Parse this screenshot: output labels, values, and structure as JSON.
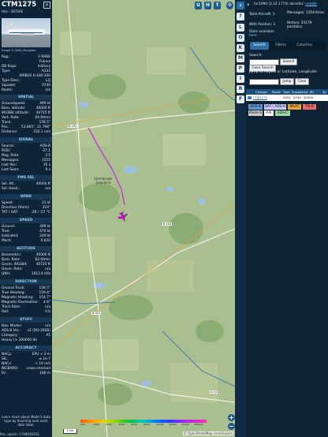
{
  "infoblock": {
    "callsign": "CTM1275",
    "hex_line": "Hex : 3B76AE",
    "photo_credit": "Image © JSMD_Mongabe",
    "reg_rows": [
      {
        "label": "Reg.:",
        "value": "F-RARE"
      },
      {
        "label": "",
        "value": "France"
      },
      {
        "label": "DB flags:",
        "value": "military"
      },
      {
        "label": "Type:",
        "value": "A332"
      },
      {
        "label": "",
        "value": "AIRBUS A-330-200"
      },
      {
        "label": "Type Desc.:",
        "value": "L2J"
      },
      {
        "label": "Squawk:",
        "value": "0740"
      },
      {
        "label": "Route:",
        "value": "n/a"
      }
    ],
    "sections": [
      {
        "title": "SPATIAL",
        "rows": [
          {
            "label": "Groundspeed:",
            "value": "499 kt"
          },
          {
            "label": "Baro. altitude:",
            "value": "40000 ft"
          },
          {
            "label": "WGS84 altitude:",
            "value": "40725 ft"
          },
          {
            "label": "Vert. Rate:",
            "value": "64 ft/min"
          },
          {
            "label": "Track:",
            "value": "158.5°"
          },
          {
            "label": "Pos.:",
            "value": "53.665°, 11.798°"
          },
          {
            "label": "Distance:",
            "value": "232.1 nmi"
          }
        ]
      },
      {
        "title": "SIGNAL",
        "rows": [
          {
            "label": "Source:",
            "value": "ADS-B"
          },
          {
            "label": "RSSI:",
            "value": "-27.1"
          },
          {
            "label": "Msg. Rate:",
            "value": "3.5"
          },
          {
            "label": "Messages:",
            "value": "1555"
          },
          {
            "label": "Last Pos.:",
            "value": "35 s"
          },
          {
            "label": "Last Seen:",
            "value": "0 s"
          }
        ]
      },
      {
        "title": "FMS SEL",
        "rows": [
          {
            "label": "Sel. Alt.:",
            "value": "40000 ft"
          },
          {
            "label": "Sel. Head.:",
            "value": "n/a"
          }
        ]
      },
      {
        "title": "WIND",
        "rows": [
          {
            "label": "Speed:",
            "value": "31 kt"
          },
          {
            "label": "Direction (from):",
            "value": "319°"
          },
          {
            "label": "TAT / OAT:",
            "value": "-28 / -57 °C"
          }
        ]
      },
      {
        "title": "SPEED",
        "rows": [
          {
            "label": "Ground:",
            "value": "499 kt"
          },
          {
            "label": "True:",
            "value": "470 kt"
          },
          {
            "label": "Indicated:",
            "value": "249 kt"
          },
          {
            "label": "Mach:",
            "value": "0.820"
          }
        ]
      },
      {
        "title": "ALTITUDE",
        "rows": [
          {
            "label": "Barometric:",
            "value": "40000 ft"
          },
          {
            "label": "Baro. Rate:",
            "value": "64 ft/min"
          },
          {
            "label": "Geom. WGS84:",
            "value": "40725 ft"
          },
          {
            "label": "Geom. Rate:",
            "value": "n/a"
          },
          {
            "label": "QNH:",
            "value": "1013.6 hPa"
          }
        ]
      },
      {
        "title": "DIRECTION",
        "rows": [
          {
            "label": "Ground Track:",
            "value": "158.5°"
          },
          {
            "label": "True Heading:",
            "value": "159.4°"
          },
          {
            "label": "Magnetic Heading:",
            "value": "154.7°"
          },
          {
            "label": "Magnetic Declination:",
            "value": "4.8°"
          },
          {
            "label": "Track Rate:",
            "value": "n/a"
          },
          {
            "label": "Roll:",
            "value": "0.0"
          }
        ]
      },
      {
        "title": "STUFF",
        "rows": [
          {
            "label": "Nav. Modes:",
            "value": "n/a"
          },
          {
            "label": "ADS-B Ver.:",
            "value": "v2 (DO-260B)"
          },
          {
            "label": "Category:",
            "value": "A5"
          },
          {
            "label": "Heavy (> 300000 lb)",
            "value": ""
          }
        ]
      },
      {
        "title": "ACCURACY",
        "rows": [
          {
            "label": "NACp:",
            "value": "EPU < 3 m"
          },
          {
            "label": "SIL:",
            "value": "≤ 1e-7"
          },
          {
            "label": "NACv:",
            "value": "< 10 m/s"
          },
          {
            "label": "NICBARO:",
            "value": "cross-checked"
          },
          {
            "label": "Rc:",
            "value": "186 m"
          }
        ]
      }
    ],
    "learn_more": "Learn more about Mode S data type by hovering over each data label.",
    "epoch": "Pos. epoch: 1748019353"
  },
  "map": {
    "controls": {
      "u": "U",
      "h": "H",
      "t": "T"
    },
    "zoom_in": "+",
    "zoom_out": "−",
    "scale_label": "1 km",
    "osm_credit": "© OpenStreetMap contributors",
    "town_label": "Sternberger Seenland",
    "road_labels": [
      "B 192",
      "B 104",
      "B 321",
      "A 14"
    ],
    "altitude_legend_ticks": [
      "500",
      "1000",
      "2000",
      "4000",
      "6000",
      "8000",
      "10000",
      "20000",
      "30000",
      "40000+"
    ],
    "aircraft_color": "#d40ad8",
    "track_color": "#c03ad6"
  },
  "toolbar": {
    "buttons": [
      "L",
      "O",
      "K",
      "M",
      "P",
      "I",
      "R",
      "F"
    ]
  },
  "sidebar": {
    "version_prefix": "tar1090 (3.14.1774) decoder:",
    "version_link": "readsb",
    "total_aircraft": "Total Aircraft: 1",
    "messages": "Messages: 1554.6/sec",
    "with_position": "With Position: 1",
    "history": "History: 25179 positions",
    "stats_available": "Stats available",
    "stats_link": "here",
    "tabs": [
      {
        "label": "Search",
        "active": true
      },
      {
        "label": "Filters",
        "active": false
      },
      {
        "label": "Columns",
        "active": false
      }
    ],
    "search_label": "Search:",
    "search_button": "Search",
    "clear_search": "Clear Search",
    "jump_label": "Jump to Airport or Latitude, Longitude:",
    "jump_button": "Jump",
    "clear_button": "Clear",
    "table_headers": [
      "Callsign",
      "Route",
      "Type",
      "Squawk",
      "Alt. (ft)",
      "Sp"
    ],
    "table_row": {
      "callsign": "CTM1275",
      "type": "A332",
      "squawk": "0740",
      "altitude": "40000"
    },
    "sources": [
      {
        "label": "ADS-B",
        "color": "#5f98d0"
      },
      {
        "label": "UAT / ADS-R",
        "color": "#c8c8ff"
      },
      {
        "label": "MLAT",
        "color": "#e8a33c"
      },
      {
        "label": "TIS-B",
        "color": "#e86a6a"
      },
      {
        "label": "Mode-S",
        "color": "#c8c8c8"
      },
      {
        "label": "AIS",
        "color": "#ffffff"
      },
      {
        "label": "ADS-C",
        "color": "#9fd39f"
      }
    ]
  }
}
